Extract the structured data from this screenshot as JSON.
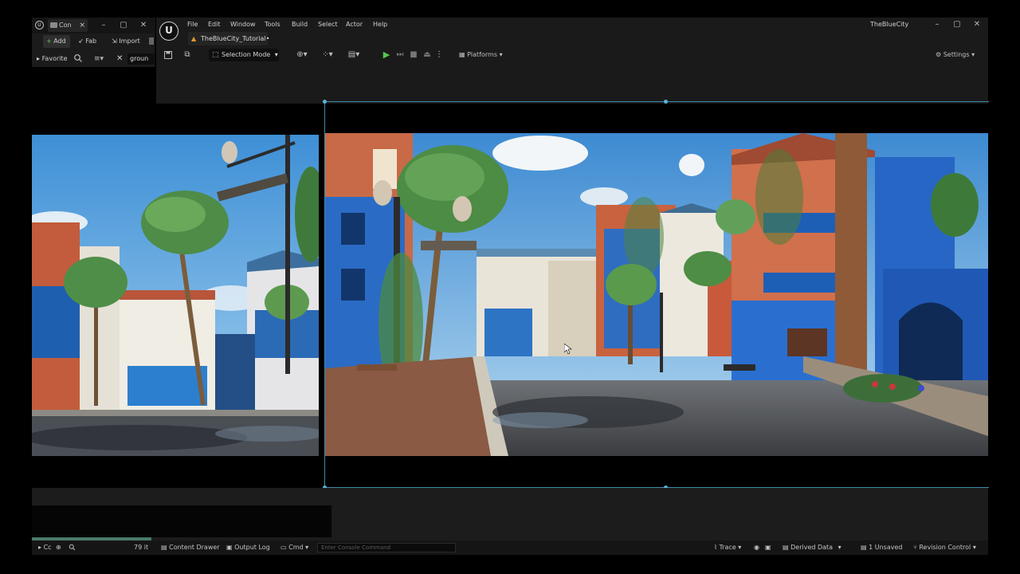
{
  "content_browser": {
    "tab_label": "Con",
    "add_label": "Add",
    "fab_label": "Fab",
    "import_label": "Import",
    "favorites_label": "Favorite",
    "search_value": "groun",
    "item_count": "79 it"
  },
  "menu": {
    "items": [
      "File",
      "Edit",
      "Window",
      "Tools",
      "Build",
      "Select",
      "Actor",
      "Help"
    ],
    "project_name": "TheBlueCity"
  },
  "level_tab": {
    "label": "TheBlueCity_Tutorial•"
  },
  "toolbar": {
    "selection_mode": "Selection Mode",
    "platforms": "Platforms",
    "settings": "Settings"
  },
  "statusbar": {
    "left_label": "Cc",
    "content_drawer": "Content Drawer",
    "output_log": "Output Log",
    "cmd": "Cmd",
    "console_placeholder": "Enter Console Command",
    "trace": "Trace",
    "derived_data": "Derived Data",
    "unsaved": "1 Unsaved",
    "revision_control": "Revision Control"
  },
  "colors": {
    "accent_frame": "#3c8ba8",
    "play_green": "#53c84a",
    "level_icon": "#e69a2e"
  },
  "icons": [
    "unreal-logo-icon",
    "save-icon",
    "search-icon",
    "filter-icon",
    "play-icon",
    "settings-gear-icon",
    "close-icon",
    "minimize-icon",
    "maximize-icon"
  ]
}
